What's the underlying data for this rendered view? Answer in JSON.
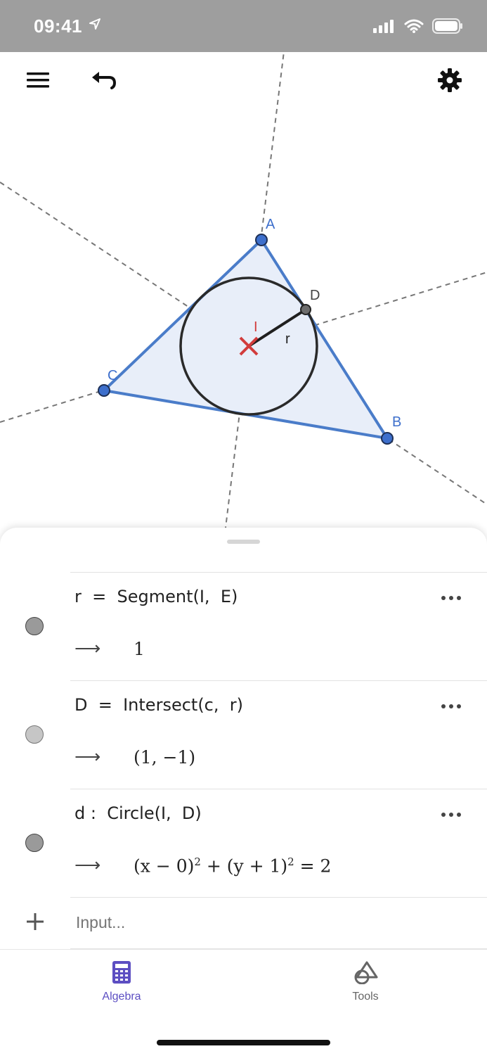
{
  "status": {
    "time": "09:41"
  },
  "canvas": {
    "points": {
      "A": "A",
      "B": "B",
      "C": "C",
      "D": "D",
      "I": "I"
    },
    "radius_label": "r"
  },
  "algebra": {
    "rows": [
      {
        "definition": "r  =  Segment(I,  E)",
        "value": "1",
        "dot_color": "#9a9a9a"
      },
      {
        "definition": "D  =  Intersect(c,  r)",
        "value": "(1, −1)",
        "dot_color": "#c6c6c6"
      },
      {
        "definition": "d :  Circle(I,  D)",
        "value_parts": [
          "(x − 0)",
          "2",
          " + (y + 1)",
          "2",
          " = 2"
        ],
        "dot_color": "#9a9a9a"
      }
    ],
    "arrow": "⟶",
    "input_placeholder": "Input..."
  },
  "nav": {
    "tabs": [
      {
        "label": "Algebra",
        "active": true
      },
      {
        "label": "Tools",
        "active": false
      }
    ]
  },
  "colors": {
    "accent": "#5c4ec2",
    "triangle": "#4a7cc9",
    "fill": "#e8eef9",
    "center": "#d23c3c"
  }
}
